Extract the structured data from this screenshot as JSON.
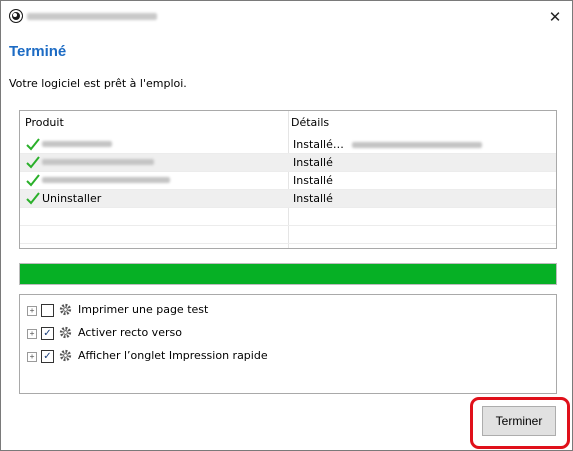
{
  "window": {
    "close_glyph": "✕"
  },
  "heading": "Terminé",
  "subtitle": "Votre logiciel est prêt à l'emploi.",
  "product_table": {
    "headers": {
      "product": "Produit",
      "details": "Détails"
    },
    "rows": [
      {
        "product": "",
        "status": "Installé…",
        "check_icon": "check-icon"
      },
      {
        "product": "",
        "status": "Installé",
        "check_icon": "check-icon"
      },
      {
        "product": "",
        "status": "Installé",
        "check_icon": "check-icon"
      },
      {
        "product": "Uninstaller",
        "status": "Installé",
        "check_icon": "check-icon"
      }
    ]
  },
  "progress": {
    "value": 1.0,
    "color": "#06b025"
  },
  "options": [
    {
      "label": "Imprimer une page test",
      "checked": false,
      "icon": "gear-icon"
    },
    {
      "label": "Activer recto verso",
      "checked": true,
      "icon": "gear-icon"
    },
    {
      "label": "Afficher l’onglet Impression rapide",
      "checked": true,
      "icon": "gear-icon"
    }
  ],
  "finish_button": {
    "label": "Terminer"
  },
  "colors": {
    "heading": "#1c6bc4",
    "highlight": "#e0101a",
    "check": "#2bb02b"
  }
}
